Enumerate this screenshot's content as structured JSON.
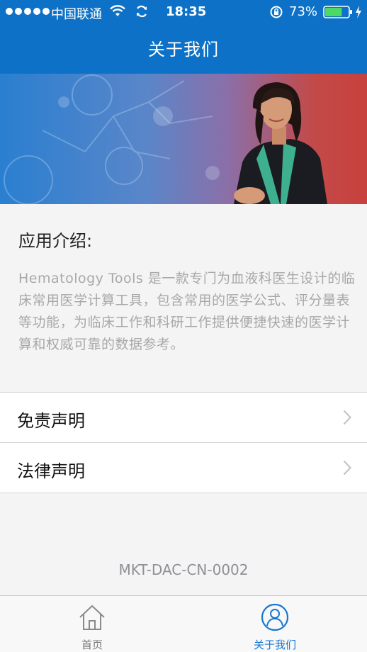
{
  "status_bar": {
    "carrier": "中国联通",
    "time": "18:35",
    "battery_percent": "73%",
    "battery_level": 0.73
  },
  "nav": {
    "title": "关于我们"
  },
  "intro": {
    "title": "应用介绍:",
    "text": "Hematology Tools 是一款专门为血液科医生设计的临床常用医学计算工具，包含常用的医学公式、评分量表等功能，为临床工作和科研工作提供便捷快速的医学计算和权威可靠的数据参考。"
  },
  "list": {
    "items": [
      {
        "label": "免责声明"
      },
      {
        "label": "法律声明"
      }
    ]
  },
  "footer": {
    "code": "MKT-DAC-CN-0002"
  },
  "tabbar": {
    "tabs": [
      {
        "label": "首页",
        "icon": "home-icon",
        "active": false
      },
      {
        "label": "关于我们",
        "icon": "user-icon",
        "active": true
      }
    ]
  },
  "colors": {
    "primary": "#0d72c7",
    "tab_active": "#1677d2",
    "battery": "#4cd964"
  }
}
